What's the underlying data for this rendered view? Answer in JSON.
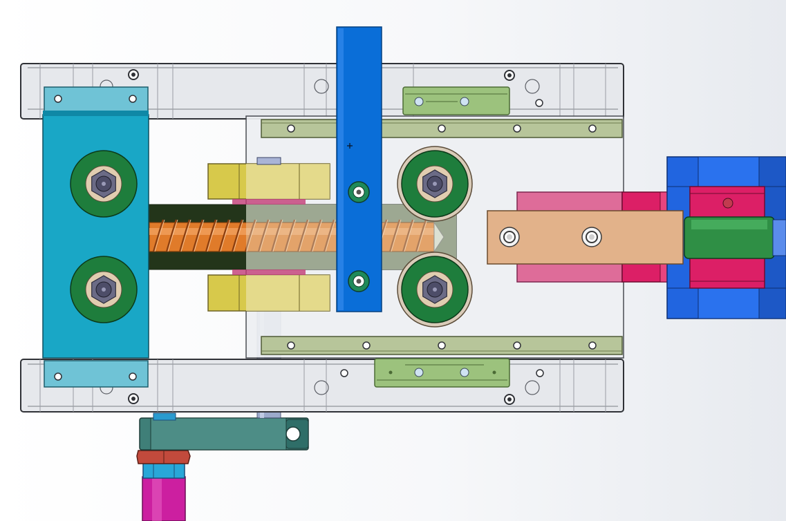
{
  "app": {
    "view": "cad-assembly-top-view"
  },
  "colors": {
    "frame_fill": "#e6e8ec",
    "frame_stroke": "#2f3136",
    "teal_block": "#19a7c6",
    "teal_tab": "#6fc3d6",
    "blue_bar": "#0a6ed8",
    "green_bearing": "#1e7d3c",
    "bearing_hub": "#6b6b86",
    "rail_green": "#aabf86",
    "slider_green": "#9cc27d",
    "yellow_block": "#d7c94b",
    "spring_orange": "#e07b2a",
    "tan_link": "#e2b28a",
    "pink_plate": "#de6c99",
    "magenta": "#dc1f66",
    "motor_blue": "#2165e0",
    "clamp_teal": "#3f7f78",
    "nut_red": "#c24a3c",
    "cylinder_magenta": "#cc1fa0"
  },
  "icons": [
    "crosshair-icon"
  ]
}
